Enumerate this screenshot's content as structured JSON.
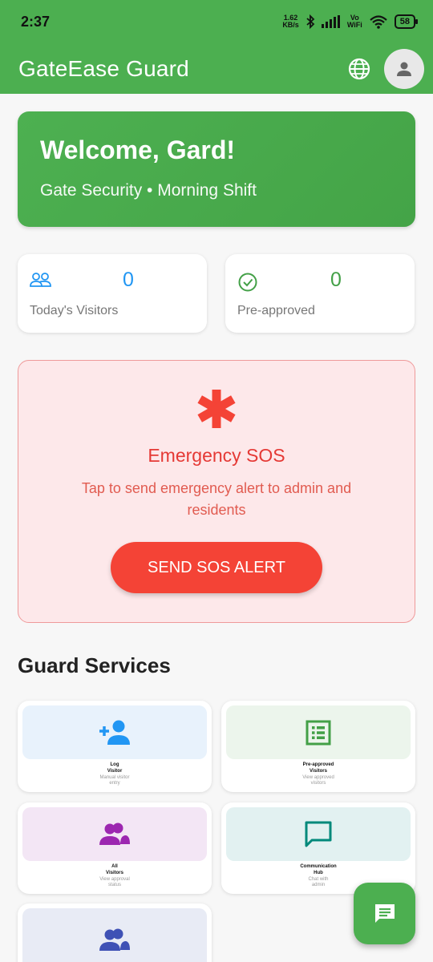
{
  "status_bar": {
    "time": "2:37",
    "net_speed_value": "1.62",
    "net_speed_unit": "KB/s",
    "vo_label": "Vo",
    "wifi_label": "WiFi",
    "battery": "58"
  },
  "app_bar": {
    "title": "GateEase Guard",
    "language_icon": "globe-icon",
    "profile_icon": "person-icon"
  },
  "welcome": {
    "heading": "Welcome, Gard!",
    "subtitle": "Gate Security • Morning Shift"
  },
  "stats": [
    {
      "icon": "people-icon",
      "value": "0",
      "label": "Today's Visitors",
      "color": "#2196f3"
    },
    {
      "icon": "check-circle-icon",
      "value": "0",
      "label": "Pre-approved",
      "color": "#43a047"
    }
  ],
  "sos": {
    "icon": "asterisk-icon",
    "title": "Emergency SOS",
    "description": "Tap to send emergency alert to admin and residents",
    "button": "SEND SOS ALERT",
    "color": "#f44336"
  },
  "services_title": "Guard Services",
  "services": [
    {
      "name1": "Log",
      "name2": "Visitor",
      "desc1": "Manual visitor",
      "desc2": "entry",
      "icon": "person-add-icon",
      "bg": "#e8f2fc",
      "color": "#2196f3"
    },
    {
      "name1": "Pre-approved",
      "name2": "Visitors",
      "desc1": "View approved",
      "desc2": "visitors",
      "icon": "list-icon",
      "bg": "#ecf5ec",
      "color": "#43a047"
    },
    {
      "name1": "All",
      "name2": "Visitors",
      "desc1": "View approval",
      "desc2": "status",
      "icon": "group-icon",
      "bg": "#f3e6f5",
      "color": "#9c27b0"
    },
    {
      "name1": "Communication",
      "name2": "Hub",
      "desc1": "Chat with",
      "desc2": "admin",
      "icon": "chat-bubble-icon",
      "bg": "#e2f1f1",
      "color": "#00897b"
    },
    {
      "icon": "group-icon",
      "bg": "#e8ebf5",
      "color": "#3f51b5"
    }
  ],
  "fab": {
    "icon": "message-icon"
  }
}
